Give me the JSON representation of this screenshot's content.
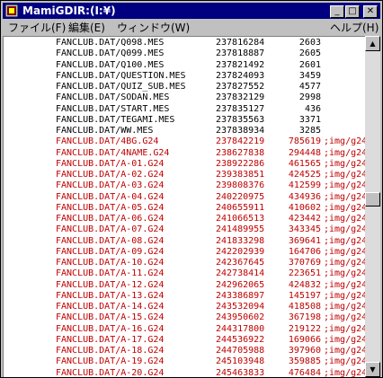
{
  "window": {
    "title": "MamiGDIR:(I:¥)"
  },
  "title_buttons": {
    "minimize": "_",
    "maximize": "□",
    "close": "✕"
  },
  "menu": {
    "file": "ファイル(F)",
    "edit": "編集(E)",
    "window": "ウィンドウ(W)",
    "help": "ヘルプ(H)"
  },
  "colors": {
    "text": "#000000",
    "highlight": "#c00000",
    "titlebar": "#000080"
  },
  "icons": {
    "app": "app-icon",
    "scroll_up": "scroll-up-arrow-icon",
    "scroll_down": "scroll-down-arrow-icon"
  },
  "listing": [
    {
      "name": "FANCLUB.DAT/Q098.MES",
      "offset": "237816284",
      "size": "2603",
      "type": "",
      "red": false
    },
    {
      "name": "FANCLUB.DAT/Q099.MES",
      "offset": "237818887",
      "size": "2605",
      "type": "",
      "red": false
    },
    {
      "name": "FANCLUB.DAT/Q100.MES",
      "offset": "237821492",
      "size": "2601",
      "type": "",
      "red": false
    },
    {
      "name": "FANCLUB.DAT/QUESTION.MES",
      "offset": "237824093",
      "size": "3459",
      "type": "",
      "red": false
    },
    {
      "name": "FANCLUB.DAT/QUIZ_SUB.MES",
      "offset": "237827552",
      "size": "4577",
      "type": "",
      "red": false
    },
    {
      "name": "FANCLUB.DAT/SODAN.MES",
      "offset": "237832129",
      "size": "2998",
      "type": "",
      "red": false
    },
    {
      "name": "FANCLUB.DAT/START.MES",
      "offset": "237835127",
      "size": "436",
      "type": "",
      "red": false
    },
    {
      "name": "FANCLUB.DAT/TEGAMI.MES",
      "offset": "237835563",
      "size": "3371",
      "type": "",
      "red": false
    },
    {
      "name": "FANCLUB.DAT/WW.MES",
      "offset": "237838934",
      "size": "3285",
      "type": "",
      "red": false
    },
    {
      "name": "FANCLUB.DAT/4BG.G24",
      "offset": "237842219",
      "size": "785619",
      "type": ";img/g24",
      "red": true
    },
    {
      "name": "FANCLUB.DAT/4NAME.G24",
      "offset": "238627838",
      "size": "294448",
      "type": ";img/g24",
      "red": true
    },
    {
      "name": "FANCLUB.DAT/A-01.G24",
      "offset": "238922286",
      "size": "461565",
      "type": ";img/g24",
      "red": true
    },
    {
      "name": "FANCLUB.DAT/A-02.G24",
      "offset": "239383851",
      "size": "424525",
      "type": ";img/g24",
      "red": true
    },
    {
      "name": "FANCLUB.DAT/A-03.G24",
      "offset": "239808376",
      "size": "412599",
      "type": ";img/g24",
      "red": true
    },
    {
      "name": "FANCLUB.DAT/A-04.G24",
      "offset": "240220975",
      "size": "434936",
      "type": ";img/g24",
      "red": true
    },
    {
      "name": "FANCLUB.DAT/A-05.G24",
      "offset": "240655911",
      "size": "410602",
      "type": ";img/g24",
      "red": true
    },
    {
      "name": "FANCLUB.DAT/A-06.G24",
      "offset": "241066513",
      "size": "423442",
      "type": ";img/g24",
      "red": true
    },
    {
      "name": "FANCLUB.DAT/A-07.G24",
      "offset": "241489955",
      "size": "343345",
      "type": ";img/g24",
      "red": true
    },
    {
      "name": "FANCLUB.DAT/A-08.G24",
      "offset": "241833298",
      "size": "369641",
      "type": ";img/g24",
      "red": true
    },
    {
      "name": "FANCLUB.DAT/A-09.G24",
      "offset": "242202939",
      "size": "164706",
      "type": ";img/g24",
      "red": true
    },
    {
      "name": "FANCLUB.DAT/A-10.G24",
      "offset": "242367645",
      "size": "370769",
      "type": ";img/g24",
      "red": true
    },
    {
      "name": "FANCLUB.DAT/A-11.G24",
      "offset": "242738414",
      "size": "223651",
      "type": ";img/g24",
      "red": true
    },
    {
      "name": "FANCLUB.DAT/A-12.G24",
      "offset": "242962065",
      "size": "424832",
      "type": ";img/g24",
      "red": true
    },
    {
      "name": "FANCLUB.DAT/A-13.G24",
      "offset": "243386897",
      "size": "145197",
      "type": ";img/g24",
      "red": true
    },
    {
      "name": "FANCLUB.DAT/A-14.G24",
      "offset": "243532094",
      "size": "418508",
      "type": ";img/g24",
      "red": true
    },
    {
      "name": "FANCLUB.DAT/A-15.G24",
      "offset": "243950602",
      "size": "367198",
      "type": ";img/g24",
      "red": true
    },
    {
      "name": "FANCLUB.DAT/A-16.G24",
      "offset": "244317800",
      "size": "219122",
      "type": ";img/g24",
      "red": true
    },
    {
      "name": "FANCLUB.DAT/A-17.G24",
      "offset": "244536922",
      "size": "169066",
      "type": ";img/g24",
      "red": true
    },
    {
      "name": "FANCLUB.DAT/A-18.G24",
      "offset": "244705988",
      "size": "397960",
      "type": ";img/g24",
      "red": true
    },
    {
      "name": "FANCLUB.DAT/A-19.G24",
      "offset": "245103948",
      "size": "359885",
      "type": ";img/g24",
      "red": true
    },
    {
      "name": "FANCLUB.DAT/A-20.G24",
      "offset": "245463833",
      "size": "476484",
      "type": ";img/g24",
      "red": true
    }
  ]
}
